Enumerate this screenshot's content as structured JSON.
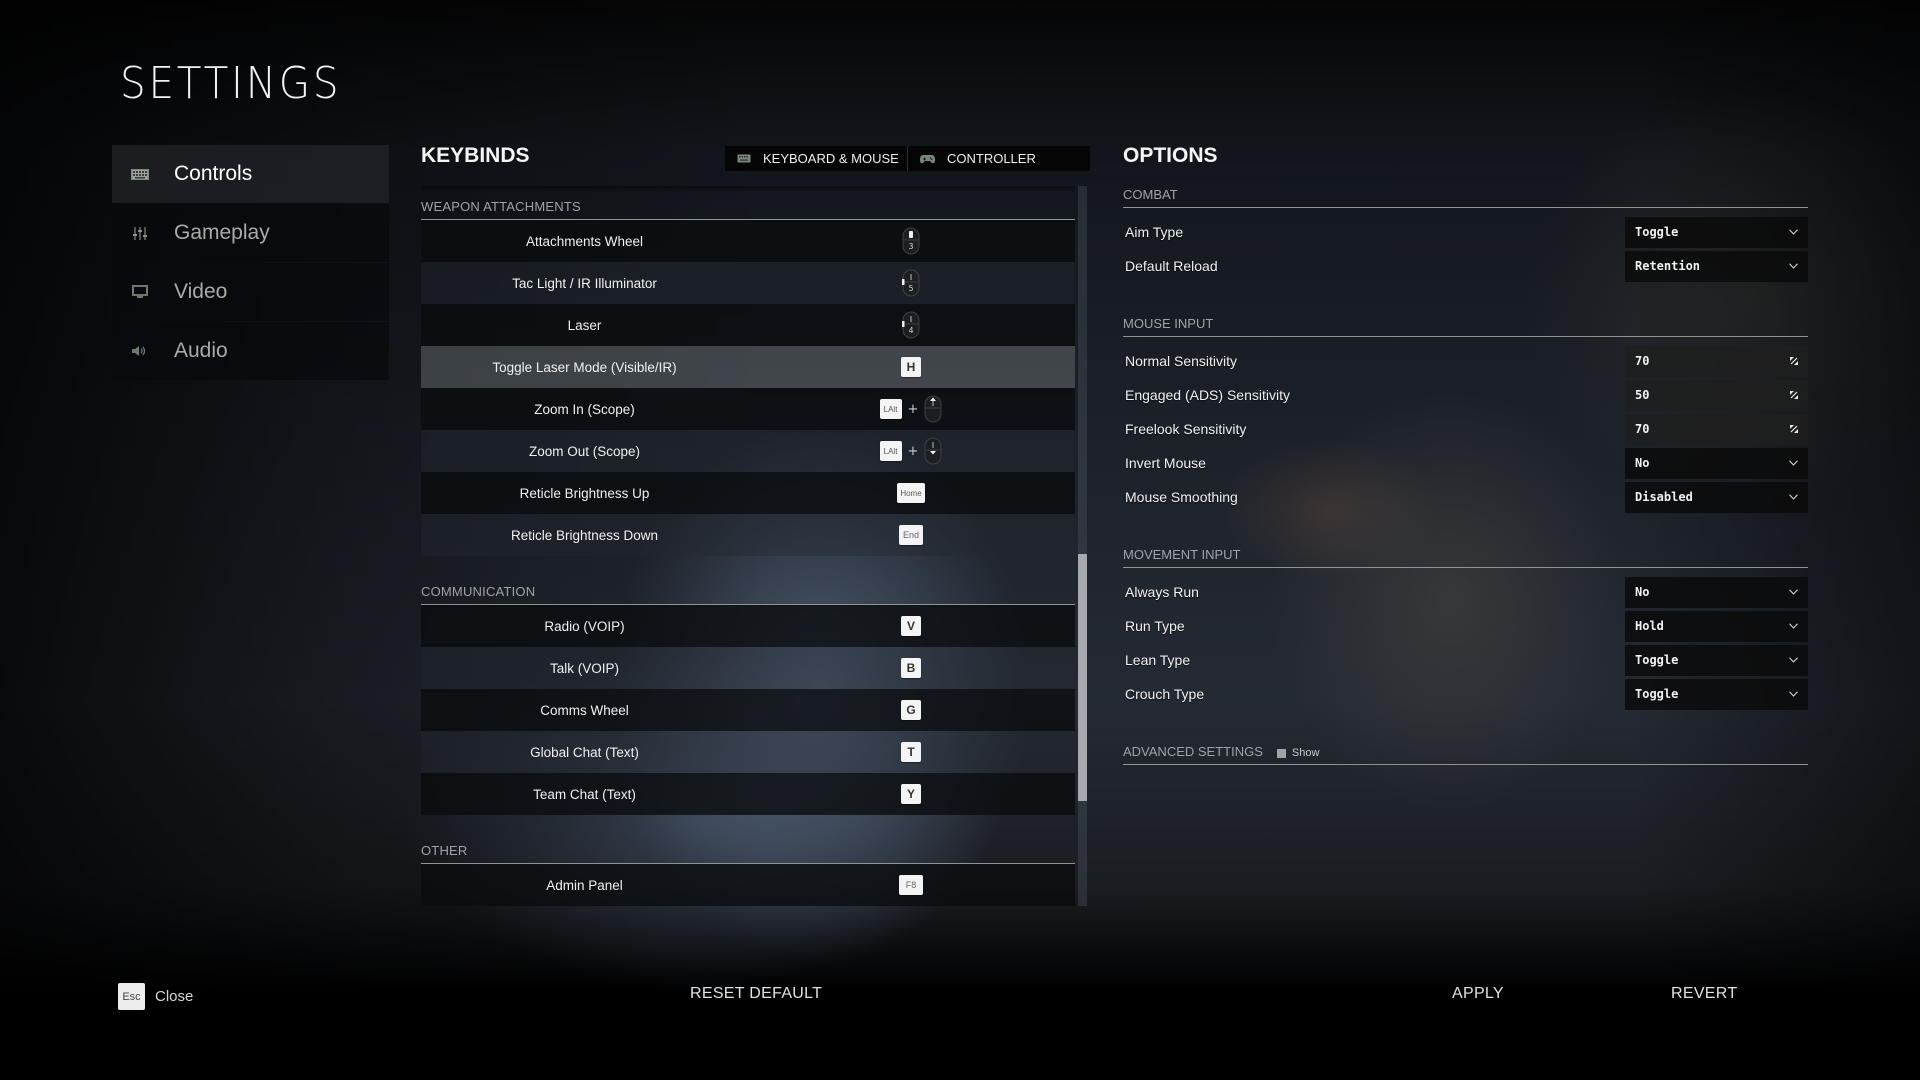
{
  "title": "SETTINGS",
  "sidebar": {
    "items": [
      {
        "label": "Controls",
        "icon": "keyboard-icon",
        "active": true
      },
      {
        "label": "Gameplay",
        "icon": "sliders-icon",
        "active": false
      },
      {
        "label": "Video",
        "icon": "monitor-icon",
        "active": false
      },
      {
        "label": "Audio",
        "icon": "speaker-icon",
        "active": false
      }
    ]
  },
  "keybinds": {
    "title": "KEYBINDS",
    "tabs": [
      {
        "label": "KEYBOARD & MOUSE",
        "icon": "keyboard-icon",
        "active": true
      },
      {
        "label": "CONTROLLER",
        "icon": "gamepad-icon",
        "active": false
      }
    ],
    "sections": [
      {
        "title": "WEAPON ATTACHMENTS",
        "rows": [
          {
            "action": "Attachments Wheel",
            "binding": [
              {
                "type": "mouse",
                "button": "3"
              }
            ]
          },
          {
            "action": "Tac Light / IR Illuminator",
            "binding": [
              {
                "type": "mouse",
                "button": "5"
              }
            ]
          },
          {
            "action": "Laser",
            "binding": [
              {
                "type": "mouse",
                "button": "4"
              }
            ]
          },
          {
            "action": "Toggle Laser Mode (Visible/IR)",
            "binding": [
              {
                "type": "key",
                "key": "H"
              }
            ],
            "highlighted": true
          },
          {
            "action": "Zoom In (Scope)",
            "binding": [
              {
                "type": "key",
                "key": "LAlt"
              },
              {
                "type": "plus",
                "key": "+"
              },
              {
                "type": "mouse",
                "button": "wheel-up"
              }
            ]
          },
          {
            "action": "Zoom Out (Scope)",
            "binding": [
              {
                "type": "key",
                "key": "LAlt"
              },
              {
                "type": "plus",
                "key": "+"
              },
              {
                "type": "mouse",
                "button": "wheel-down"
              }
            ]
          },
          {
            "action": "Reticle Brightness Up",
            "binding": [
              {
                "type": "key",
                "key": "Home"
              }
            ]
          },
          {
            "action": "Reticle Brightness Down",
            "binding": [
              {
                "type": "key",
                "key": "End"
              }
            ]
          }
        ]
      },
      {
        "title": "COMMUNICATION",
        "rows": [
          {
            "action": "Radio (VOIP)",
            "binding": [
              {
                "type": "key",
                "key": "V"
              }
            ]
          },
          {
            "action": "Talk (VOIP)",
            "binding": [
              {
                "type": "key",
                "key": "B"
              }
            ]
          },
          {
            "action": "Comms Wheel",
            "binding": [
              {
                "type": "key",
                "key": "G"
              }
            ]
          },
          {
            "action": "Global Chat (Text)",
            "binding": [
              {
                "type": "key",
                "key": "T"
              }
            ]
          },
          {
            "action": "Team Chat (Text)",
            "binding": [
              {
                "type": "key",
                "key": "Y"
              }
            ]
          }
        ]
      },
      {
        "title": "OTHER",
        "rows": [
          {
            "action": "Admin Panel",
            "binding": [
              {
                "type": "key",
                "key": "F8"
              }
            ]
          },
          {
            "action": "",
            "binding": [
              {
                "type": "key",
                "key": ""
              }
            ]
          }
        ]
      }
    ],
    "scroll_position": 0.51
  },
  "options": {
    "title": "OPTIONS",
    "sections": [
      {
        "title": "COMBAT",
        "rows": [
          {
            "label": "Aim Type",
            "value": "Toggle",
            "control": "dropdown"
          },
          {
            "label": "Default Reload",
            "value": "Retention",
            "control": "dropdown"
          }
        ]
      },
      {
        "title": "MOUSE INPUT",
        "rows": [
          {
            "label": "Normal Sensitivity",
            "value": "70",
            "control": "slider"
          },
          {
            "label": "Engaged (ADS) Sensitivity",
            "value": "50",
            "control": "slider"
          },
          {
            "label": "Freelook Sensitivity",
            "value": "70",
            "control": "slider"
          },
          {
            "label": "Invert Mouse",
            "value": "No",
            "control": "dropdown"
          },
          {
            "label": "Mouse Smoothing",
            "value": "Disabled",
            "control": "dropdown"
          }
        ]
      },
      {
        "title": "MOVEMENT INPUT",
        "rows": [
          {
            "label": "Always Run",
            "value": "No",
            "control": "dropdown"
          },
          {
            "label": "Run Type",
            "value": "Hold",
            "control": "dropdown"
          },
          {
            "label": "Lean Type",
            "value": "Toggle",
            "control": "dropdown"
          },
          {
            "label": "Crouch Type",
            "value": "Toggle",
            "control": "dropdown"
          }
        ]
      }
    ],
    "advanced": {
      "label": "ADVANCED SETTINGS",
      "checkbox_label": "Show",
      "checked": false
    }
  },
  "footer": {
    "close_key": "Esc",
    "close_label": "Close",
    "reset_label": "RESET DEFAULT",
    "apply_label": "APPLY",
    "revert_label": "REVERT"
  }
}
